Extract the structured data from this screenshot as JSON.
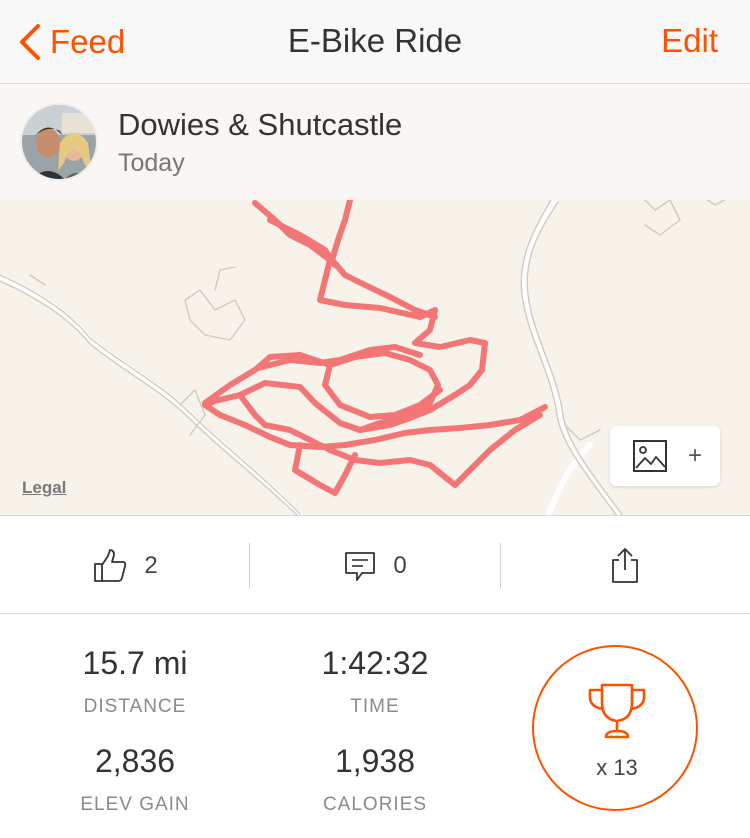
{
  "nav": {
    "back_label": "Feed",
    "title": "E-Bike Ride",
    "edit_label": "Edit",
    "accent_color": "#fc5200"
  },
  "athlete": {
    "name": "Dowies & Shutcastle",
    "date": "Today"
  },
  "map": {
    "legal_label": "Legal",
    "add_photo_plus": "+",
    "route_color": "#f26c6c"
  },
  "social": {
    "kudos_count": "2",
    "comment_count": "0",
    "icons": [
      "thumbs-up-icon",
      "comment-icon",
      "share-icon"
    ]
  },
  "stats": {
    "distance": {
      "value": "15.7 mi",
      "label": "DISTANCE"
    },
    "time": {
      "value": "1:42:32",
      "label": "TIME"
    },
    "elev_gain": {
      "value": "2,836",
      "label": "ELEV GAIN"
    },
    "calories": {
      "value": "1,938",
      "label": "CALORIES"
    },
    "achievements": "x 13"
  }
}
